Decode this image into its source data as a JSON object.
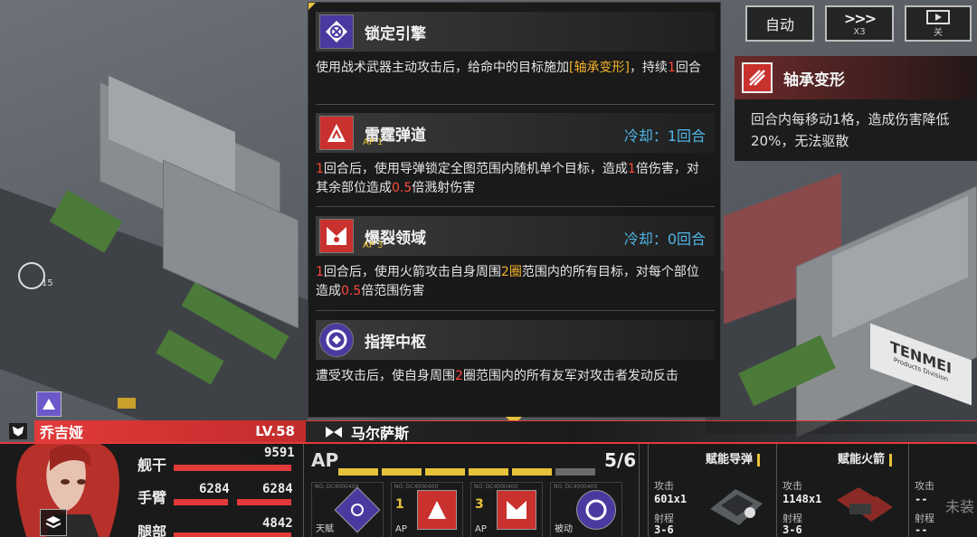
{
  "top_buttons": {
    "auto": "自动",
    "speed_icon": ">>>",
    "speed": "X3",
    "replay_sub": "关"
  },
  "map": {
    "turn_counter": "15",
    "building_sign": "TENMEI",
    "building_sub": "Products Division"
  },
  "skills": [
    {
      "name": "锁定引擎",
      "icon": "lock-engine-icon",
      "desc_parts": [
        "使用战术武器主动攻击后，给命中的目标施加",
        "[轴承变形]",
        "，持续",
        "1",
        "回合"
      ]
    },
    {
      "name": "雷霆弹道",
      "icon": "thunder-missile-icon",
      "ap": "AP 1",
      "cooldown": "冷却：1回合",
      "desc_parts": [
        "1",
        "回合后，使用导弹锁定全图范围内随机单个目标，造成",
        "1",
        "倍伤害，对其余部位造成",
        "0.5",
        "倍溅射伤害"
      ]
    },
    {
      "name": "爆裂领域",
      "icon": "burst-field-icon",
      "ap": "AP 3",
      "cooldown": "冷却：0回合",
      "desc_parts": [
        "1",
        "回合后，使用火箭攻击自身周围",
        "2圈",
        "范围内的所有目标，对每个部位造成",
        "0.5",
        "倍范围伤害"
      ]
    },
    {
      "name": "指挥中枢",
      "icon": "command-hub-icon",
      "desc_parts": [
        "遭受攻击后，使自身周围",
        "2",
        "圈范围内的所有友军对攻击者发动反击"
      ]
    }
  ],
  "status_effect": {
    "name": "轴承变形",
    "icon": "bearing-deform-icon",
    "desc": "回合内每移动1格，造成伤害降低20%，无法驱散"
  },
  "pilot": {
    "name": "乔吉娅",
    "level": "LV.58",
    "mech_name": "马尔萨斯",
    "stats": {
      "hull_label": "舰干",
      "hull_value": "9591",
      "hull_fill": 1.0,
      "arm_label": "手臂",
      "arm_left": "6284",
      "arm_right": "6284",
      "leg_label": "腿部",
      "leg_value": "4842"
    }
  },
  "ap": {
    "label": "AP",
    "value": "5/6",
    "current": 5,
    "max": 6
  },
  "skill_slots": [
    {
      "tag": "NO. DC4000400",
      "label": "天赋",
      "icon": "lock-engine-icon"
    },
    {
      "tag": "NO. DC4000400",
      "ap_num": "1",
      "label": "AP",
      "icon": "thunder-missile-icon"
    },
    {
      "tag": "NO. DC4000400",
      "ap_num": "3",
      "label": "AP",
      "icon": "burst-field-icon"
    },
    {
      "tag": "NO. DC4000400",
      "label": "被动",
      "icon": "command-hub-icon"
    }
  ],
  "weapons": [
    {
      "title": "赋能导弹",
      "atk_label": "攻击",
      "atk": "601x1",
      "range_label": "射程",
      "range": "3-6"
    },
    {
      "title": "赋能火箭",
      "atk_label": "攻击",
      "atk": "1148x1",
      "range_label": "射程",
      "range": "3-6"
    },
    {
      "title": "",
      "atk_label": "攻击",
      "atk": "--",
      "range_label": "射程",
      "range": "--",
      "unequipped": "未装"
    }
  ],
  "colors": {
    "accent_red": "#e23a3a",
    "accent_gold": "#e6c23a",
    "cooldown_blue": "#4fb6e8",
    "highlight_red": "#ff4a3c"
  }
}
